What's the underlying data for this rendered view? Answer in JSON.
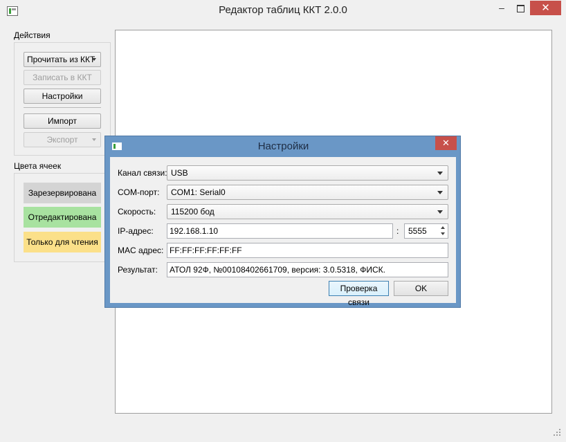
{
  "window": {
    "title": "Редактор таблиц ККТ 2.0.0",
    "minimize": "–",
    "close": "✕"
  },
  "actions": {
    "title": "Действия",
    "read_label": "Прочитать из ККТ",
    "write_label": "Записать в ККТ",
    "settings_label": "Настройки",
    "import_label": "Импорт",
    "export_label": "Экспорт"
  },
  "cell_colors": {
    "title": "Цвета ячеек",
    "items": [
      {
        "label": "Зарезервирована",
        "color": "#d4d4d4"
      },
      {
        "label": "Отредактирована",
        "color": "#a8e2a0"
      },
      {
        "label": "Только для чтения",
        "color": "#fbe089"
      }
    ]
  },
  "dialog": {
    "title": "Настройки",
    "close": "✕",
    "channel_label": "Канал связи:",
    "channel_value": "USB",
    "com_label": "COM-порт:",
    "com_value": "COM1: Serial0",
    "speed_label": "Скорость:",
    "speed_value": "115200 бод",
    "ip_label": "IP-адрес:",
    "ip_value": "192.168.1.10",
    "port_sep": ":",
    "port_value": "5555",
    "mac_label": "MAC адрес:",
    "mac_value": "FF:FF:FF:FF:FF:FF",
    "result_label": "Результат:",
    "result_value": "АТОЛ 92Ф, №00108402661709, версия: 3.0.5318, ФИСК.",
    "check_label": "Проверка связи",
    "ok_label": "OK"
  }
}
